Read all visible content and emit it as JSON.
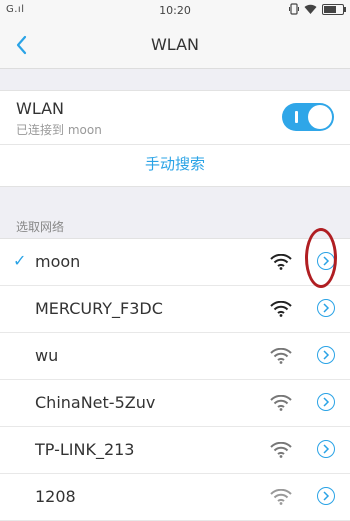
{
  "status_bar": {
    "signal": "G.ıl",
    "time": "10:20"
  },
  "nav": {
    "title": "WLAN"
  },
  "wlan": {
    "label": "WLAN",
    "status": "已连接到 moon",
    "toggle_on": true,
    "manual_search": "手动搜索"
  },
  "networks_header": "选取网络",
  "networks": [
    {
      "name": "moon",
      "connected": true
    },
    {
      "name": "MERCURY_F3DC",
      "connected": false
    },
    {
      "name": "wu",
      "connected": false
    },
    {
      "name": "ChinaNet-5Zuv",
      "connected": false
    },
    {
      "name": "TP-LINK_213",
      "connected": false
    },
    {
      "name": "1208",
      "connected": false
    }
  ],
  "icons": {
    "back": "chevron-left-icon",
    "wifi": "wifi-icon",
    "info": "info-arrow-icon",
    "check": "checkmark-icon"
  },
  "colors": {
    "accent": "#2aa3e6",
    "annotation": "#b01e22"
  }
}
